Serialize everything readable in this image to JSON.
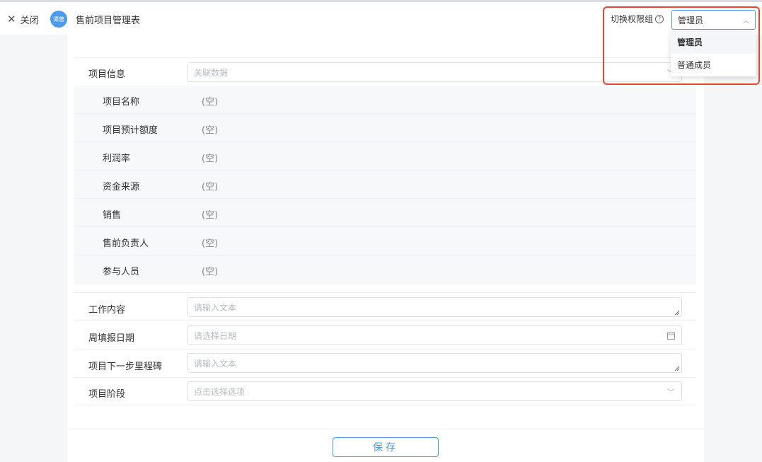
{
  "header": {
    "close_label": "关闭",
    "avatar_text": "谭普",
    "title": "售前项目管理表",
    "perm_label": "切换权限组",
    "perm_selected": "管理员"
  },
  "dropdown": {
    "options": [
      "管理员",
      "普通成员"
    ]
  },
  "form": {
    "project_info": {
      "label": "项目信息",
      "placeholder": "关联数据"
    },
    "sub_fields": [
      {
        "label": "项目名称",
        "value": "(空)"
      },
      {
        "label": "项目预计额度",
        "value": "(空)"
      },
      {
        "label": "利润率",
        "value": "(空)"
      },
      {
        "label": "资金来源",
        "value": "(空)"
      },
      {
        "label": "销售",
        "value": "(空)"
      },
      {
        "label": "售前负责人",
        "value": "(空)"
      },
      {
        "label": "参与人员",
        "value": "(空)"
      }
    ],
    "work_content": {
      "label": "工作内容",
      "placeholder": "请输入文本"
    },
    "week_date": {
      "label": "周填报日期",
      "placeholder": "请选择日期"
    },
    "next_milestone": {
      "label": "项目下一步里程碑",
      "placeholder": "请输入文本"
    },
    "stage": {
      "label": "项目阶段",
      "placeholder": "点击选择选项"
    }
  },
  "footer": {
    "save_label": "保存"
  },
  "colors": {
    "accent": "#4a9bf0",
    "highlight": "#e4472a"
  }
}
